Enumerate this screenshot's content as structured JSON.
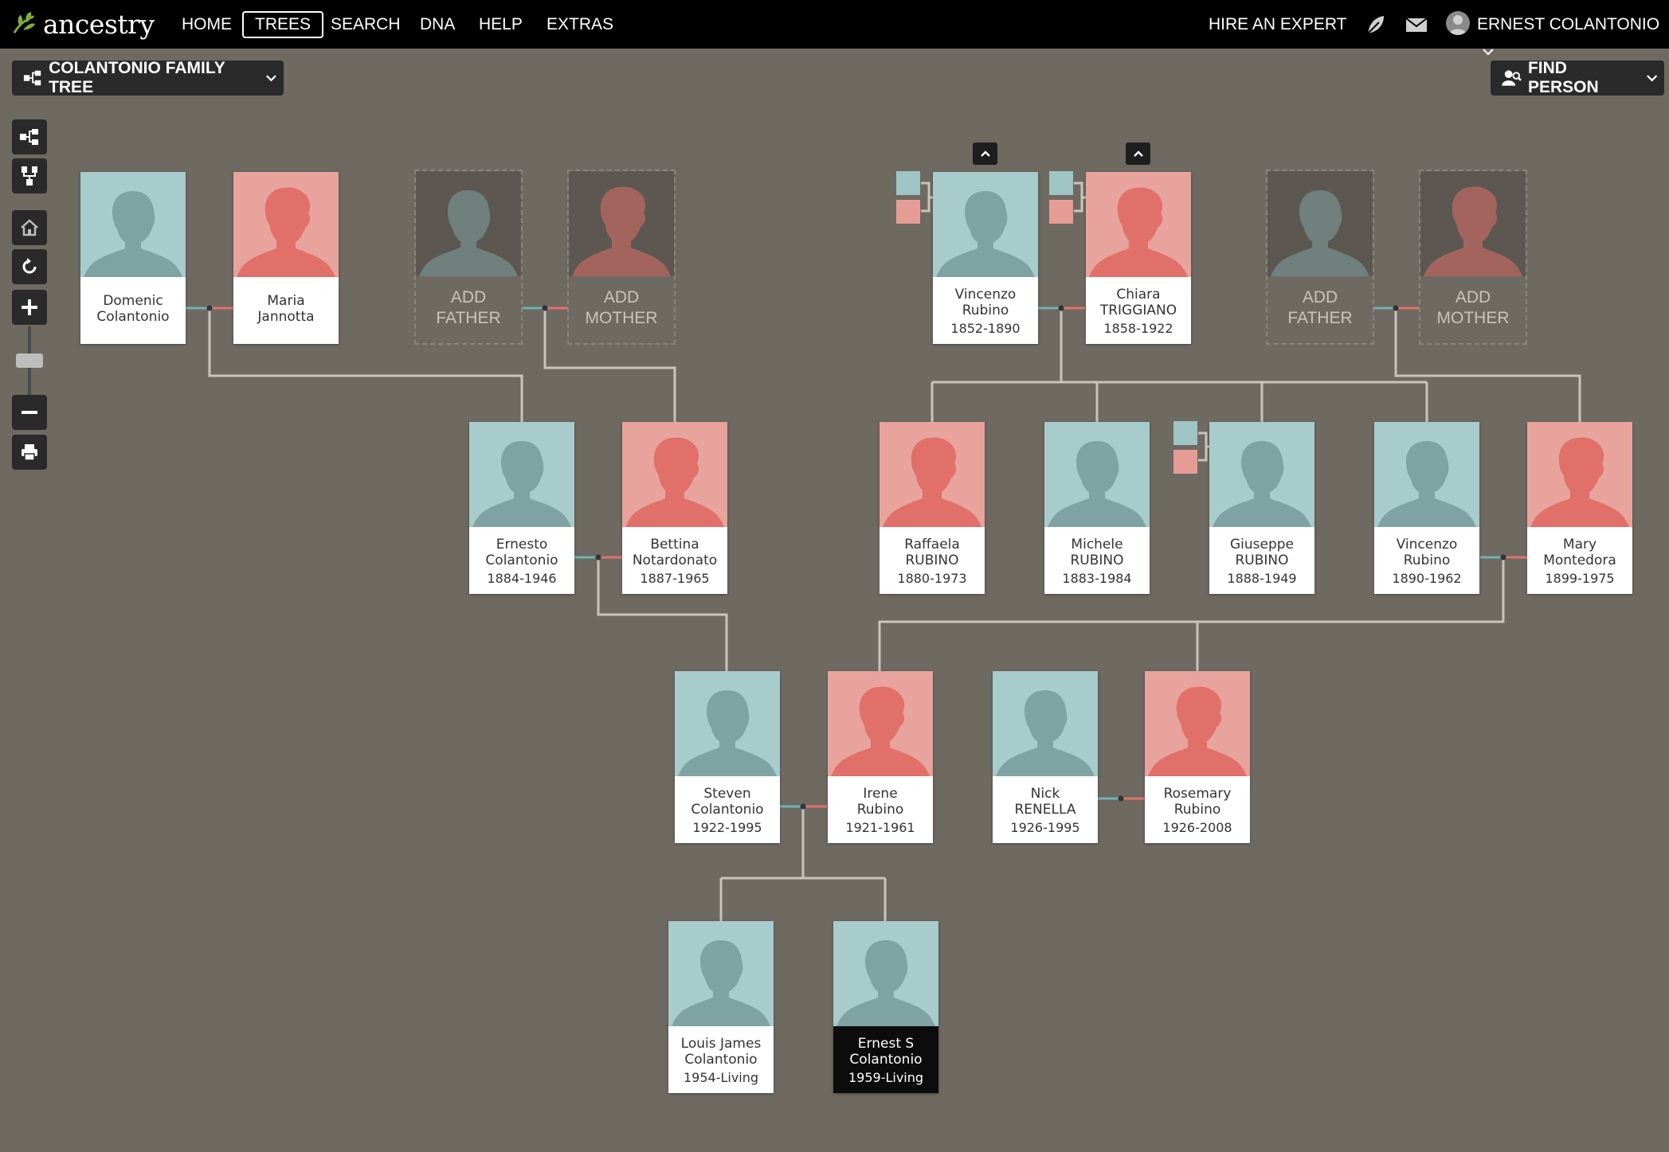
{
  "nav": {
    "logo_text": "ancestry",
    "items": [
      "HOME",
      "TREES",
      "SEARCH",
      "DNA",
      "HELP",
      "EXTRAS"
    ],
    "active": "TREES",
    "hire": "HIRE AN EXPERT",
    "user": "ERNEST COLANTONIO"
  },
  "tree_title": "COLANTONIO FAMILY TREE",
  "find_person": "FIND PERSON",
  "add_father": [
    "ADD",
    "FATHER"
  ],
  "add_mother": [
    "ADD",
    "MOTHER"
  ],
  "people": {
    "domenic": {
      "line1": "Domenic",
      "line2": "Colantonio",
      "dates": "",
      "sex": "male"
    },
    "maria": {
      "line1": "Maria",
      "line2": "Jannotta",
      "dates": "",
      "sex": "female"
    },
    "vincenzo1": {
      "line1": "Vincenzo",
      "line2": "Rubino",
      "dates": "1852-1890",
      "sex": "male"
    },
    "chiara": {
      "line1": "Chiara",
      "line2": "TRIGGIANO",
      "dates": "1858-1922",
      "sex": "female"
    },
    "ernesto": {
      "line1": "Ernesto",
      "line2": "Colantonio",
      "dates": "1884-1946",
      "sex": "male"
    },
    "bettina": {
      "line1": "Bettina",
      "line2": "Notardonato",
      "dates": "1887-1965",
      "sex": "female"
    },
    "raffaela": {
      "line1": "Raffaela",
      "line2": "RUBINO",
      "dates": "1880-1973",
      "sex": "female"
    },
    "michele": {
      "line1": "Michele",
      "line2": "RUBINO",
      "dates": "1883-1984",
      "sex": "male"
    },
    "giuseppe": {
      "line1": "Giuseppe",
      "line2": "RUBINO",
      "dates": "1888-1949",
      "sex": "male"
    },
    "vincenzo2": {
      "line1": "Vincenzo",
      "line2": "Rubino",
      "dates": "1890-1962",
      "sex": "male"
    },
    "mary": {
      "line1": "Mary",
      "line2": "Montedora",
      "dates": "1899-1975",
      "sex": "female"
    },
    "steven": {
      "line1": "Steven",
      "line2": "Colantonio",
      "dates": "1922-1995",
      "sex": "male"
    },
    "irene": {
      "line1": "Irene",
      "line2": "Rubino",
      "dates": "1921-1961",
      "sex": "female"
    },
    "nick": {
      "line1": "Nick",
      "line2": "RENELLA",
      "dates": "1926-1995",
      "sex": "male"
    },
    "rosemary": {
      "line1": "Rosemary",
      "line2": "Rubino",
      "dates": "1926-2008",
      "sex": "female"
    },
    "louis": {
      "line1": "Louis James",
      "line2": "Colantonio",
      "dates": "1954-Living",
      "sex": "male"
    },
    "ernest": {
      "line1": "Ernest S",
      "line2": "Colantonio",
      "dates": "1959-Living",
      "sex": "male"
    }
  },
  "colors": {
    "background": "#6e6961",
    "male_photo": "#a8cbcb",
    "female_photo": "#e7a39c",
    "male_line": "#6fb3b3",
    "female_line": "#e0726a",
    "connector": "#c9c4bb"
  }
}
